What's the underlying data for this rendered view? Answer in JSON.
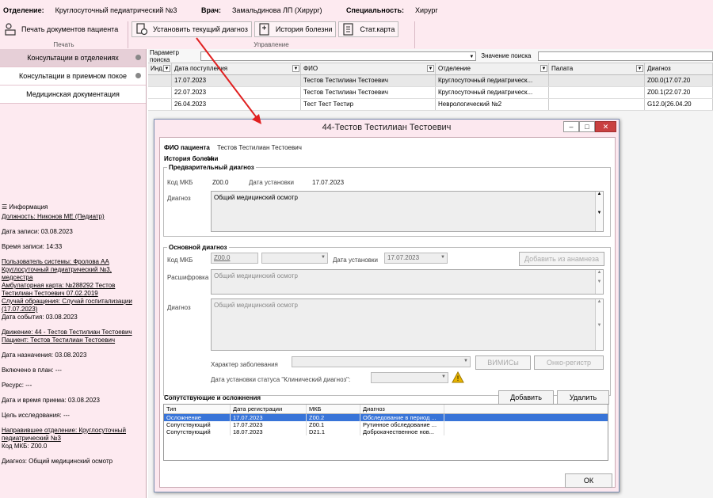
{
  "header": {
    "department_label": "Отделение:",
    "department_value": "Круглосуточный педиатрический №3",
    "doctor_label": "Врач:",
    "doctor_value": "Замальдинова ЛП (Хирург)",
    "specialty_label": "Специальность:",
    "specialty_value": "Хирург"
  },
  "ribbon": {
    "print_btn": "Печать документов пациента",
    "print_caption": "Печать",
    "set_diag_btn": "Установить текущий диагноз",
    "history_btn": "История болезни",
    "statcard_btn": "Стат.карта",
    "manage_caption": "Управление"
  },
  "sidebar": {
    "items": [
      {
        "label": "Консультации в отделениях"
      },
      {
        "label": "Консультации в приемном покое"
      },
      {
        "label": "Медицинская документация"
      }
    ],
    "info_title": "Информация",
    "info_lines": [
      "Должность: Никонов МЕ (Педиатр)",
      "Дата записи: 03.08.2023",
      "Время записи: 14:33",
      "Пользователь системы: Фролова АА Круглосуточный педиатрический №3, медсестра",
      "Амбулаторная карта: №288292 Тестов Тестилиан Тестоевич 07.02.2019",
      "Случай обращения: Случай госпитализации (17.07.2023)",
      "Дата события: 03.08.2023",
      "Движение: 44 - Тестов Тестилиан Тестоевич",
      "Пациент: Тестов Тестилиан Тестоевич",
      "Дата назначения: 03.08.2023",
      "Включено в план: ---",
      "Ресурс: ---",
      "Дата и время приема: 03.08.2023",
      "Цель исследования: ---",
      "Направившее отделение: Круглосуточный педиатрический №3",
      "Код МКБ: Z00.0",
      "Диагноз: Общий медицинский осмотр"
    ]
  },
  "search": {
    "param_label": "Параметр поиска",
    "value_label": "Значение поиска"
  },
  "grid": {
    "headers": [
      "Инд...",
      "Дата поступления",
      "ФИО",
      "Отделение",
      "Палата",
      "Диагноз"
    ],
    "rows": [
      [
        "",
        "17.07.2023",
        "Тестов Тестилиан Тестоевич",
        "Круглосуточный педиатрическ...",
        "",
        "Z00.0(17.07.20"
      ],
      [
        "",
        "22.07.2023",
        "Тестов Тестилиан Тестоевич",
        "Круглосуточный педиатрическ...",
        "",
        "Z00.1(22.07.20"
      ],
      [
        "",
        "26.04.2023",
        "Тест Тест Тестир",
        "Неврологический №2",
        "",
        "G12.0(26.04.20"
      ]
    ]
  },
  "dialog": {
    "title": "44-Тестов Тестилиан Тестоевич",
    "fio_label": "ФИО пациента",
    "fio_value": "Тестов Тестилиан Тестоевич",
    "history_label": "История болезни",
    "history_value": "44",
    "prelim": {
      "legend": "Предварительный диагноз",
      "mkb_label": "Код МКБ",
      "mkb_value": "Z00.0",
      "date_label": "Дата установки",
      "date_value": "17.07.2023",
      "diag_label": "Диагноз",
      "diag_value": "Общий медицинский осмотр"
    },
    "main": {
      "legend": "Основной диагноз",
      "mkb_label": "Код МКБ",
      "mkb_value": "Z00.0",
      "date_label": "Дата установки",
      "date_value": "17.07.2023",
      "add_from_history": "Добавить из анамнеза",
      "decode_label": "Расшифровка",
      "decode_value": "Общий медицинский осмотр",
      "diag_label": "Диагноз",
      "diag_value": "Общий медицинский осмотр",
      "character_label": "Характер заболевания",
      "vimis_btn": "ВИМИСы",
      "onco_btn": "Онко-регистр",
      "clinical_date_label": "Дата установки статуса \"Клинический диагноз\":"
    },
    "comp": {
      "title": "Сопутствующие и осложнения",
      "add_btn": "Добавить",
      "delete_btn": "Удалить",
      "headers": [
        "Тип",
        "Дата регистрации",
        "МКБ",
        "Диагноз"
      ],
      "rows": [
        [
          "Осложнение",
          "17.07.2023",
          "Z00.2",
          "Обследование в период ..."
        ],
        [
          "Сопутствующий",
          "17.07.2023",
          "Z00.1",
          "Рутинное обследование ..."
        ],
        [
          "Сопутствующий",
          "18.07.2023",
          "D21.1",
          "Доброкачественное нов..."
        ]
      ]
    },
    "ok_btn": "ОК"
  },
  "colors": {
    "accent_pink": "#fdeaf0",
    "selection_blue": "#3874d8",
    "arrow_red": "#e02020",
    "close_red": "#c94040"
  }
}
